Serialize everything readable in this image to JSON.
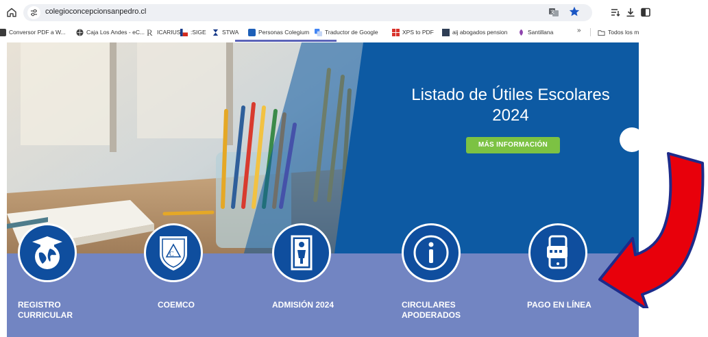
{
  "browser": {
    "url": "colegioconcepcionsanpedro.cl",
    "bookmarks": [
      {
        "label": "Conversor PDF a W...",
        "icon": "pdf-converter-icon",
        "color": "#3a3a3a"
      },
      {
        "label": "Caja Los Andes - eC...",
        "icon": "globe-icon",
        "color": "#444444"
      },
      {
        "label": "ICARIUS",
        "icon": "r-logo-icon",
        "color": "#555555"
      },
      {
        "label": ":SIGE",
        "icon": "flag-icon",
        "color": "#d52b1e"
      },
      {
        "label": "STWA",
        "icon": "hourglass-icon",
        "color": "#1a3c8a"
      },
      {
        "label": "Personas Colegium",
        "icon": "colegium-icon",
        "color": "#1d5fb8"
      },
      {
        "label": "Traductor de Google",
        "icon": "google-translate-icon",
        "color": "#4285f4"
      },
      {
        "label": "XPS to PDF",
        "icon": "xps-icon",
        "color": "#d8322b"
      },
      {
        "label": "aij abogados pension",
        "icon": "aij-icon",
        "color": "#2f3e55"
      },
      {
        "label": "Santillana",
        "icon": "santillana-icon",
        "color": "#8e44ad"
      },
      {
        "label": "Todos los m",
        "icon": "folder-icon",
        "color": "#555555"
      }
    ],
    "more": "»"
  },
  "hero": {
    "title": "Listado de Útiles Escolares 2024",
    "button": "MÁS INFORMACIÓN"
  },
  "services": [
    {
      "label": "REGISTRO CURRICULAR",
      "icon": "graduation-globe-icon"
    },
    {
      "label": "COEMCO",
      "icon": "coemco-shield-icon"
    },
    {
      "label": "ADMISIÓN 2024",
      "icon": "door-person-icon"
    },
    {
      "label": "CIRCULARES APODERADOS",
      "icon": "info-icon"
    },
    {
      "label": "PAGO EN LÍNEA",
      "icon": "mobile-payment-icon"
    }
  ],
  "colors": {
    "hero_blue": "#0d5aa3",
    "band": "#7285c2",
    "icon_circle": "#0f4e9e",
    "cta_green": "#7cc243",
    "arrow_red": "#e8000b"
  }
}
